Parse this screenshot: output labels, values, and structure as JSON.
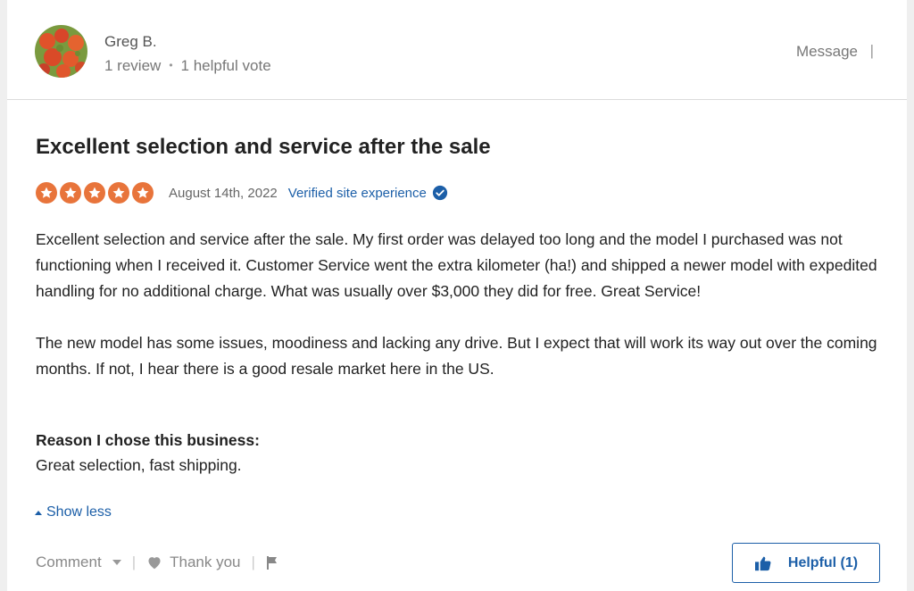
{
  "reviewer": {
    "name": "Greg B.",
    "review_count": "1 review",
    "helpful_votes": "1 helpful vote",
    "separator": "•",
    "message_label": "Message",
    "pipe": "|"
  },
  "review": {
    "title": "Excellent selection and service after the sale",
    "rating": 5,
    "star_color": "#e8743b",
    "date": "August 14th, 2022",
    "verified_label": "Verified site experience",
    "paragraphs": [
      "Excellent selection and service after the sale. My first order was delayed too long and the model I purchased was not functioning when I received it. Customer Service went the extra kilometer (ha!) and shipped a newer model with expedited handling for no additional charge. What was usually over $3,000 they did for free. Great Service!",
      "The new model has some issues, moodiness and lacking any drive. But I expect that will work its way out over the coming months. If not, I hear there is a good resale market here in the US."
    ],
    "reason_title": "Reason I chose this business:",
    "reason_text": "Great selection, fast shipping.",
    "show_less_label": "Show less"
  },
  "actions": {
    "comment_label": "Comment",
    "thank_you_label": "Thank you",
    "helpful_label": "Helpful (1)",
    "icons": [
      "chevron-down-icon",
      "heart-icon",
      "flag-icon",
      "thumbs-up-icon"
    ]
  },
  "colors": {
    "accent_blue": "#1c5fa8",
    "star_orange": "#e8743b"
  }
}
